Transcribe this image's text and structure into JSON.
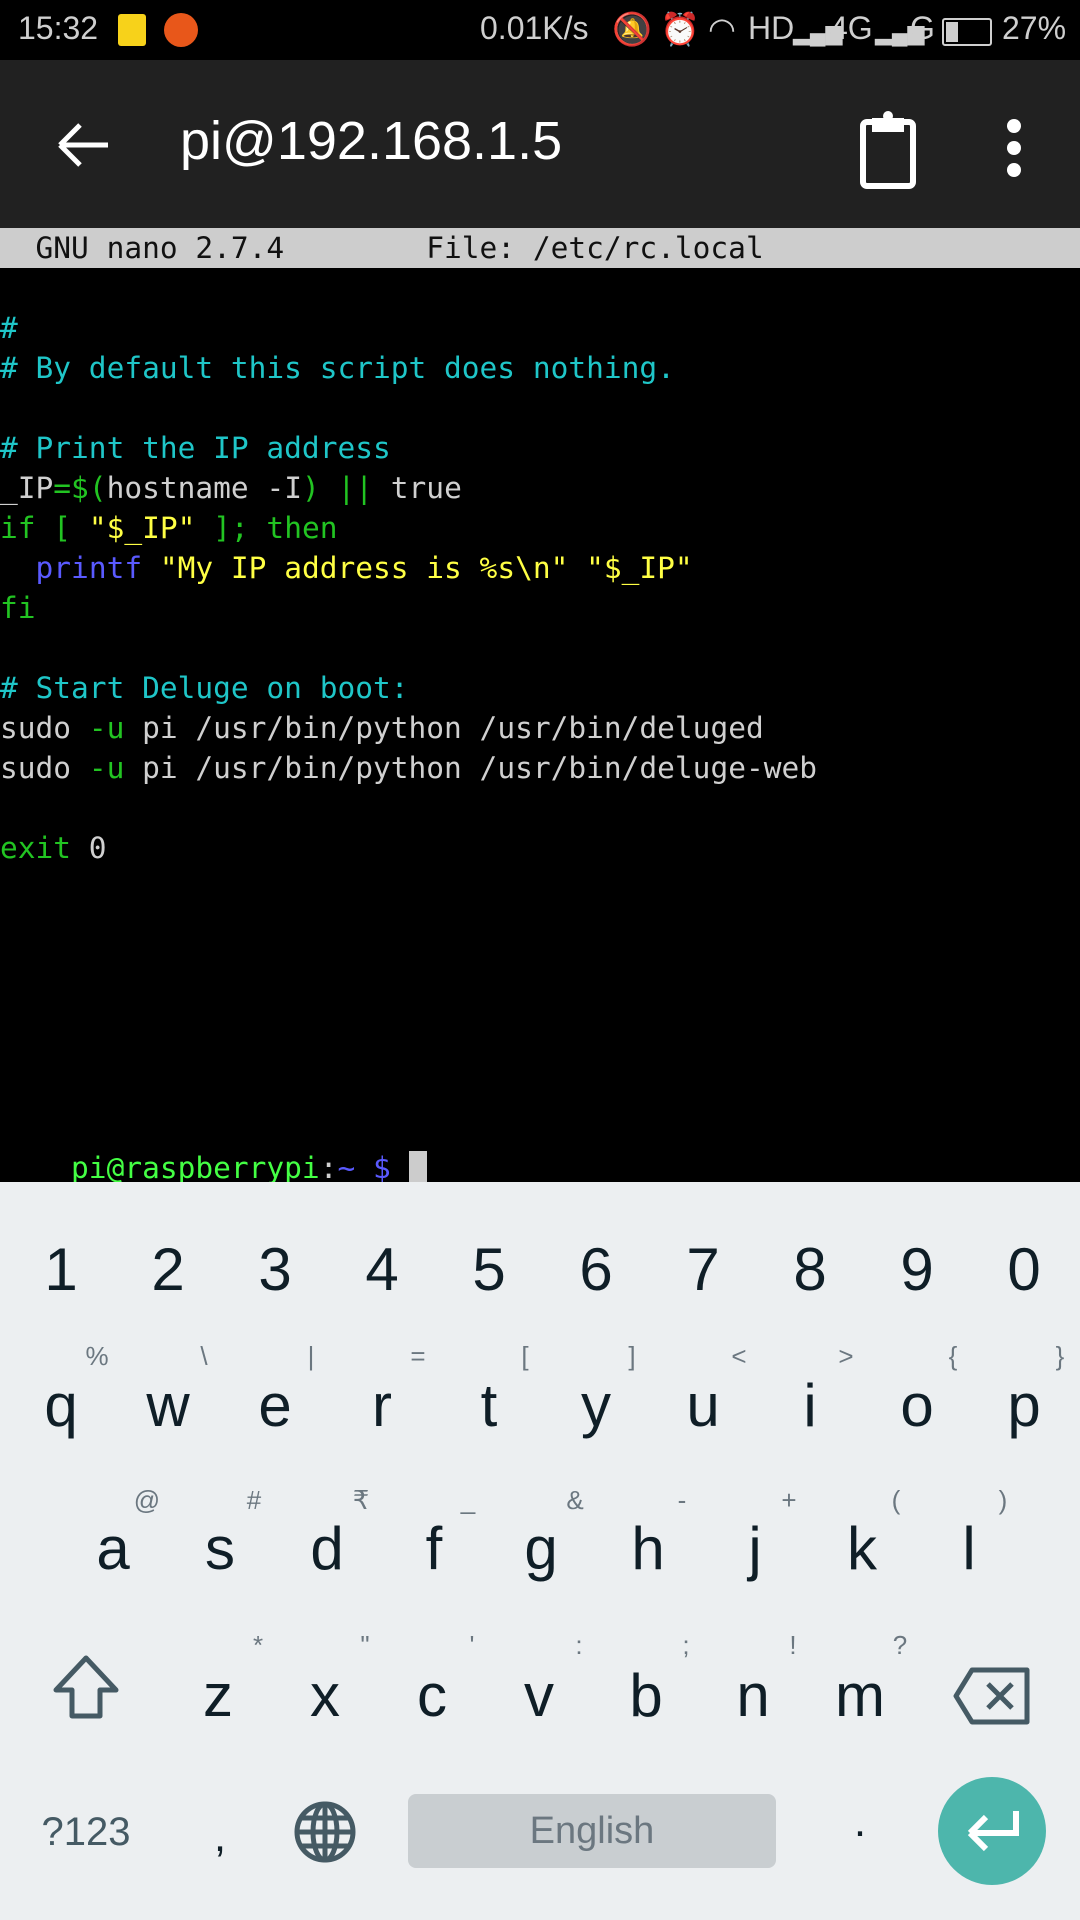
{
  "status_bar": {
    "time": "15:32",
    "net_speed": "0.01K/s",
    "hd": "HD",
    "net1": "4G",
    "net2": "G",
    "battery": "27%",
    "battery_level": 27
  },
  "toolbar": {
    "title": "pi@192.168.1.5",
    "icons": [
      "back-arrow-icon",
      "clipboard-icon",
      "more-vert-icon"
    ]
  },
  "colors": {
    "comment": "#1fc6c8",
    "keyword": "#22c422",
    "string": "#ffff44",
    "builtin": "#5a5aff",
    "text": "#d0d0d0",
    "prompt": "#44ff44",
    "accent": "#4db6ac"
  },
  "terminal": {
    "nano_header": "  GNU nano 2.7.4        File: /etc/rc.local",
    "lines": [
      {
        "row": 2,
        "segments": [
          {
            "t": "#",
            "c": "comment"
          }
        ]
      },
      {
        "row": 3,
        "segments": [
          {
            "t": "# By default this script does nothing.",
            "c": "comment"
          }
        ]
      },
      {
        "row": 5,
        "segments": [
          {
            "t": "# Print the IP address",
            "c": "comment"
          }
        ]
      },
      {
        "row": 6,
        "segments": [
          {
            "t": "_IP",
            "c": "text"
          },
          {
            "t": "=$(",
            "c": "keyword"
          },
          {
            "t": "hostname -I",
            "c": "text"
          },
          {
            "t": ") || ",
            "c": "keyword"
          },
          {
            "t": "true",
            "c": "text"
          }
        ]
      },
      {
        "row": 7,
        "segments": [
          {
            "t": "if [ ",
            "c": "keyword"
          },
          {
            "t": "\"$_IP\"",
            "c": "string"
          },
          {
            "t": " ]; then",
            "c": "keyword"
          }
        ]
      },
      {
        "row": 8,
        "segments": [
          {
            "t": "  ",
            "c": "text"
          },
          {
            "t": "printf",
            "c": "builtin"
          },
          {
            "t": " \"My IP address is %s\\n\" \"$_IP\"",
            "c": "string"
          }
        ]
      },
      {
        "row": 9,
        "segments": [
          {
            "t": "fi",
            "c": "keyword"
          }
        ]
      },
      {
        "row": 11,
        "segments": [
          {
            "t": "# Start Deluge on boot:",
            "c": "comment"
          }
        ]
      },
      {
        "row": 12,
        "segments": [
          {
            "t": "sudo ",
            "c": "text"
          },
          {
            "t": "-u",
            "c": "keyword"
          },
          {
            "t": " pi /usr/bin/python /usr/bin/deluged",
            "c": "text"
          }
        ]
      },
      {
        "row": 13,
        "segments": [
          {
            "t": "sudo ",
            "c": "text"
          },
          {
            "t": "-u",
            "c": "keyword"
          },
          {
            "t": " pi /usr/bin/python /usr/bin/deluge-web",
            "c": "text"
          }
        ]
      },
      {
        "row": 15,
        "segments": [
          {
            "t": "exit",
            "c": "keyword"
          },
          {
            "t": " 0",
            "c": "text"
          }
        ]
      }
    ],
    "prompt": {
      "user_host": "pi@raspberrypi",
      "colon": ":",
      "path": "~",
      "symbol": " $ "
    }
  },
  "keyboard": {
    "numbers": [
      "1",
      "2",
      "3",
      "4",
      "5",
      "6",
      "7",
      "8",
      "9",
      "0"
    ],
    "row1": [
      "q",
      "w",
      "e",
      "r",
      "t",
      "y",
      "u",
      "i",
      "o",
      "p"
    ],
    "row1_hints": [
      "%",
      "\\",
      "|",
      "=",
      "[",
      "]",
      "<",
      ">",
      "{",
      "}"
    ],
    "row2": [
      "a",
      "s",
      "d",
      "f",
      "g",
      "h",
      "j",
      "k",
      "l"
    ],
    "row2_hints": [
      "@",
      "#",
      "₹",
      "_",
      "&",
      "-",
      "+",
      "(",
      ")"
    ],
    "row3": [
      "z",
      "x",
      "c",
      "v",
      "b",
      "n",
      "m"
    ],
    "row3_hints": [
      "*",
      "\"",
      "'",
      ":",
      ";",
      "!",
      "?"
    ],
    "symbols_label": "?123",
    "comma": ",",
    "space_label": "English",
    "period": "."
  }
}
